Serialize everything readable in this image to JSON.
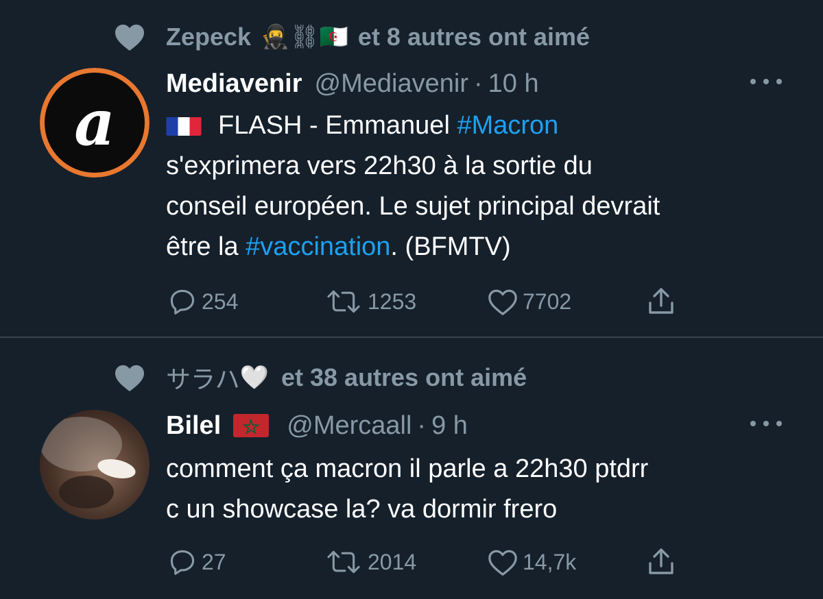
{
  "tweets": [
    {
      "social_context": {
        "liker_name": "Zepeck",
        "liker_emojis": "🥷⛓🇩🇿",
        "rest": "et 8 autres ont aimé"
      },
      "author": {
        "display_name": "Mediavenir",
        "handle": "@Mediavenir",
        "separator": "·",
        "time": "10 h",
        "avatar_letter": "a"
      },
      "body": {
        "line1_prefix": "FLASH - Emmanuel ",
        "line1_hashtag": "#Macron",
        "line2": "s'exprimera vers 22h30 à la sortie du",
        "line3": "conseil européen. Le sujet principal devrait",
        "line4_prefix": "être la ",
        "line4_hashtag": "#vaccination",
        "line4_suffix": ". (BFMTV)"
      },
      "counts": {
        "replies": "254",
        "retweets": "1253",
        "likes": "7702"
      }
    },
    {
      "social_context": {
        "liker_name": "サラハ",
        "liker_emojis": "🤍",
        "rest": "et 38 autres ont aimé"
      },
      "author": {
        "display_name": "Bilel",
        "handle": "@Mercaall",
        "separator": "·",
        "time": "9 h"
      },
      "body": {
        "line1": "comment ça macron il parle a 22h30 ptdrr",
        "line2": "c un showcase la? va dormir frero"
      },
      "counts": {
        "replies": "27",
        "retweets": "2014",
        "likes": "14,7k"
      }
    }
  ],
  "colors": {
    "background": "#15202b",
    "secondary_text": "#8899a6",
    "link": "#1da1f2",
    "divider": "#38444d",
    "avatar_ring": "#e8782f"
  }
}
